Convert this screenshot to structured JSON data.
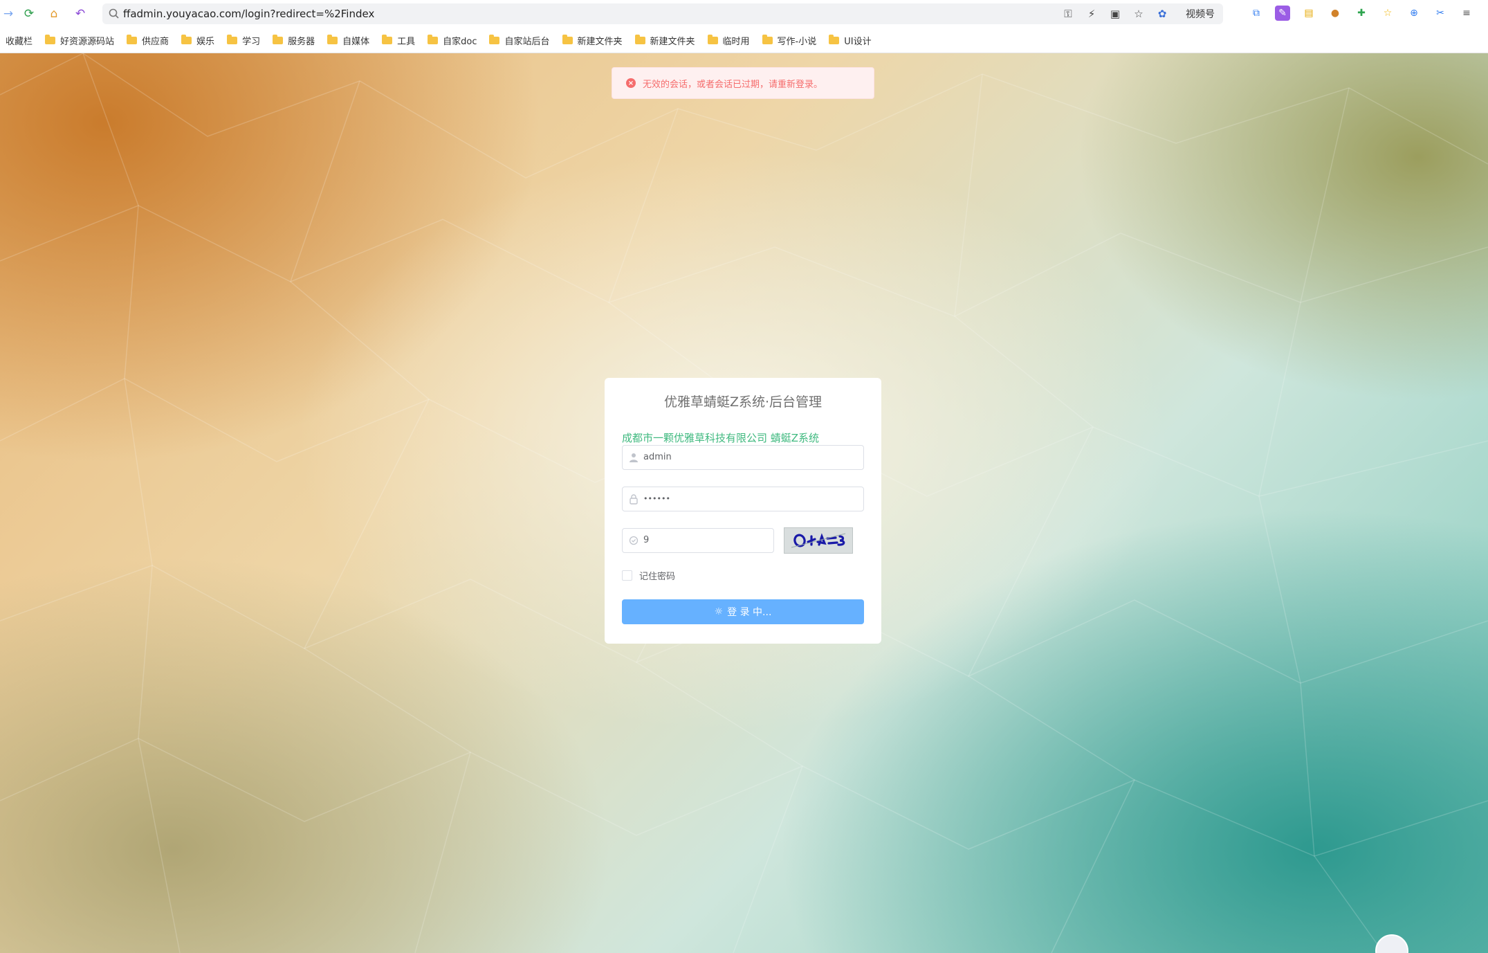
{
  "browser": {
    "url": "ffadmin.youyacao.com/login?redirect=%2Findex",
    "video_label": "视频号"
  },
  "bookmarks": [
    {
      "label": "收藏栏",
      "folder": false
    },
    {
      "label": "好资源源码站",
      "folder": true
    },
    {
      "label": "供应商",
      "folder": true
    },
    {
      "label": "娱乐",
      "folder": true
    },
    {
      "label": "学习",
      "folder": true
    },
    {
      "label": "服务器",
      "folder": true
    },
    {
      "label": "自媒体",
      "folder": true
    },
    {
      "label": "工具",
      "folder": true
    },
    {
      "label": "自家doc",
      "folder": true
    },
    {
      "label": "自家站后台",
      "folder": true
    },
    {
      "label": "新建文件夹",
      "folder": true
    },
    {
      "label": "新建文件夹",
      "folder": true
    },
    {
      "label": "临时用",
      "folder": true
    },
    {
      "label": "写作-小说",
      "folder": true
    },
    {
      "label": "UI设计",
      "folder": true
    }
  ],
  "toast": {
    "message": "无效的会话，或者会话已过期，请重新登录。"
  },
  "login": {
    "title": "优雅草蜻蜓Z系统·后台管理",
    "company": "成都市一颗优雅草科技有限公司 蜻蜓Z系统",
    "username": "admin",
    "password_mask": "••••••",
    "captcha_value": "9",
    "remember_label": "记住密码",
    "button_label": "登 录 中..."
  },
  "colors": {
    "accent_green": "#3fb97f",
    "button_blue": "#66b1ff",
    "error_red": "#f56c6c"
  }
}
